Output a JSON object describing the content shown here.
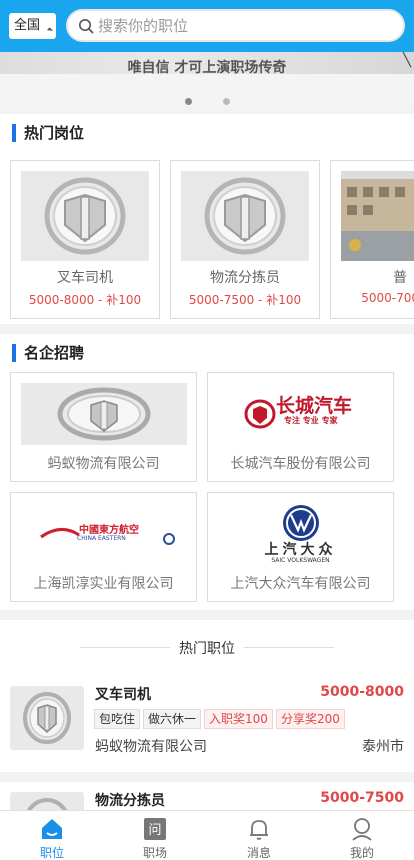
{
  "header": {
    "city": "全国",
    "search_placeholder": "搜索你的职位"
  },
  "banner": {
    "slogan": "唯自信 才可上演职场传奇",
    "slides": 2
  },
  "hot_jobs": {
    "title": "热门岗位",
    "items": [
      {
        "name": "叉车司机",
        "salary": "5000-8000 - 补100"
      },
      {
        "name": "物流分拣员",
        "salary": "5000-7500 - 补100"
      },
      {
        "name": "普",
        "salary": "5000-700"
      }
    ]
  },
  "companies": {
    "title": "名企招聘",
    "items": [
      {
        "name": "蚂蚁物流有限公司"
      },
      {
        "name": "长城汽车股份有限公司",
        "logo_text": "长城汽车",
        "logo_sub": "专注 专业 专家"
      },
      {
        "name": "上海凯淳实业有限公司",
        "logo_text": "中國東方航空",
        "logo_sub": "CHINA EASTERN"
      },
      {
        "name": "上汽大众汽车有限公司",
        "logo_text": "上汽大众",
        "logo_sub": "SAIC VOLKSWAGEN"
      }
    ]
  },
  "hot_positions": {
    "title": "热门职位",
    "items": [
      {
        "title": "叉车司机",
        "pay": "5000-8000",
        "tags": [
          "包吃住",
          "做六休一"
        ],
        "red_tags": [
          "入职奖100",
          "分享奖200"
        ],
        "company": "蚂蚁物流有限公司",
        "city": "泰州市"
      },
      {
        "title": "物流分拣员",
        "pay": "5000-7500"
      }
    ]
  },
  "tabbar": {
    "items": [
      {
        "label": "职位",
        "icon": "home-icon"
      },
      {
        "label": "职场",
        "icon": "question-icon"
      },
      {
        "label": "消息",
        "icon": "bell-icon"
      },
      {
        "label": "我的",
        "icon": "user-icon"
      }
    ]
  },
  "colors": {
    "primary": "#1aa6ee",
    "accent": "#1a73e8",
    "salary": "#e04848"
  }
}
